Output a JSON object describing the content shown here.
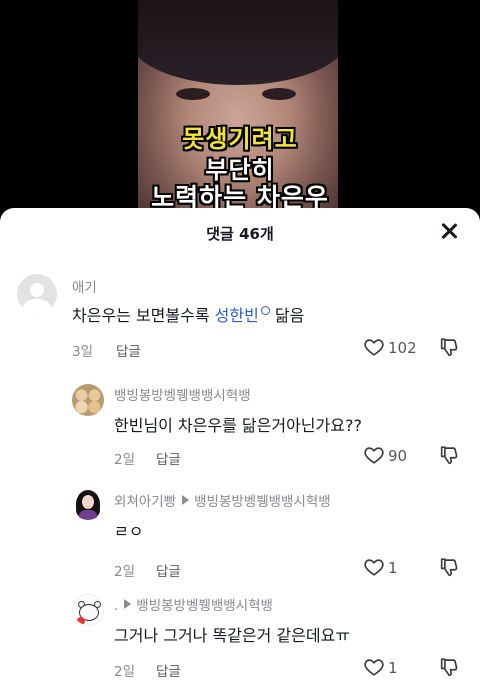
{
  "video": {
    "caption_lines": [
      "못생기려고",
      "부단히",
      "노력하는 차은우"
    ]
  },
  "comments_sheet": {
    "title": "댓글 46개",
    "comments": [
      {
        "username": "애기",
        "text_prefix": "차은우는 보면볼수록 ",
        "link_text": "성한빈",
        "text_suffix": " 닮음",
        "time": "3일",
        "reply_label": "답글",
        "like_count": "102"
      },
      {
        "username": "뱅빙봉방벵뷍뱅뱅시혁뱅",
        "text": "한빈님이 차은우를 닮은거아닌가요??",
        "time": "2일",
        "reply_label": "답글",
        "like_count": "90"
      },
      {
        "username": "외쳐아기빵",
        "reply_to": "뱅빙봉방벵뷍뱅뱅시혁뱅",
        "text": "ㄹㅇ",
        "time": "2일",
        "reply_label": "답글",
        "like_count": "1"
      },
      {
        "username": ".",
        "reply_to": "뱅빙봉방벵뷍뱅뱅시혁뱅",
        "text": "그거나 그거나 똑같은거 같은데요ㅠ",
        "time": "2일",
        "reply_label": "답글",
        "like_count": "1"
      }
    ]
  }
}
